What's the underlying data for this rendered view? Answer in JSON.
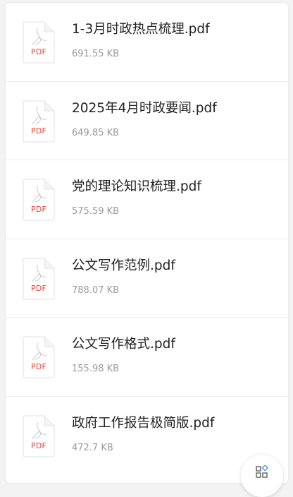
{
  "files": [
    {
      "name": "1-3月时政热点梳理.pdf",
      "size": "691.55 KB",
      "type_label": "PDF"
    },
    {
      "name": "2025年4月时政要闻.pdf",
      "size": "649.85 KB",
      "type_label": "PDF"
    },
    {
      "name": "党的理论知识梳理.pdf",
      "size": "575.59 KB",
      "type_label": "PDF"
    },
    {
      "name": "公文写作范例.pdf",
      "size": "788.07 KB",
      "type_label": "PDF"
    },
    {
      "name": "公文写作格式.pdf",
      "size": "155.98 KB",
      "type_label": "PDF"
    },
    {
      "name": "政府工作报告极简版.pdf",
      "size": "472.7 KB",
      "type_label": "PDF"
    }
  ],
  "fab": {
    "icon": "apps-grid-icon"
  },
  "colors": {
    "pdf_accent": "#e0433b",
    "name_text": "#222222",
    "size_text": "#9a9a9a"
  }
}
